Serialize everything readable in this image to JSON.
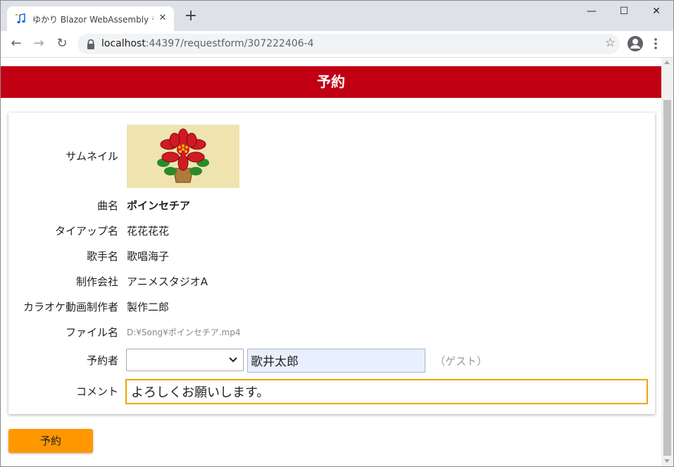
{
  "browser": {
    "tab_title": "ゆかり Blazor WebAssembly デモ",
    "tab_close": "✕",
    "new_tab": "+",
    "window_minimize": "—",
    "window_maximize": "☐",
    "window_close": "✕",
    "back": "←",
    "forward": "→",
    "reload": "↻",
    "url_host": "localhost",
    "url_rest": ":44397/requestform/307222406-4",
    "bookmark": "☆"
  },
  "page": {
    "header_title": "予約",
    "fields": {
      "thumbnail_label": "サムネイル",
      "song_label": "曲名",
      "song_value": "ポインセチア",
      "tieup_label": "タイアップ名",
      "tieup_value": "花花花花",
      "artist_label": "歌手名",
      "artist_value": "歌唱海子",
      "studio_label": "制作会社",
      "studio_value": "アニメスタジオA",
      "maker_label": "カラオケ動画制作者",
      "maker_value": "製作二郎",
      "file_label": "ファイル名",
      "file_value": "D:¥Song¥ポインセチア.mp4",
      "requester_label": "予約者",
      "requester_select_value": "",
      "requester_name": "歌井太郎",
      "requester_note": "（ゲスト）",
      "comment_label": "コメント",
      "comment_value": "よろしくお願いします。"
    },
    "submit_label": "予約"
  },
  "colors": {
    "header_bg": "#c20014",
    "submit_bg": "#ff9800",
    "comment_border": "#f0a500",
    "name_input_bg": "#e8f0fe"
  }
}
